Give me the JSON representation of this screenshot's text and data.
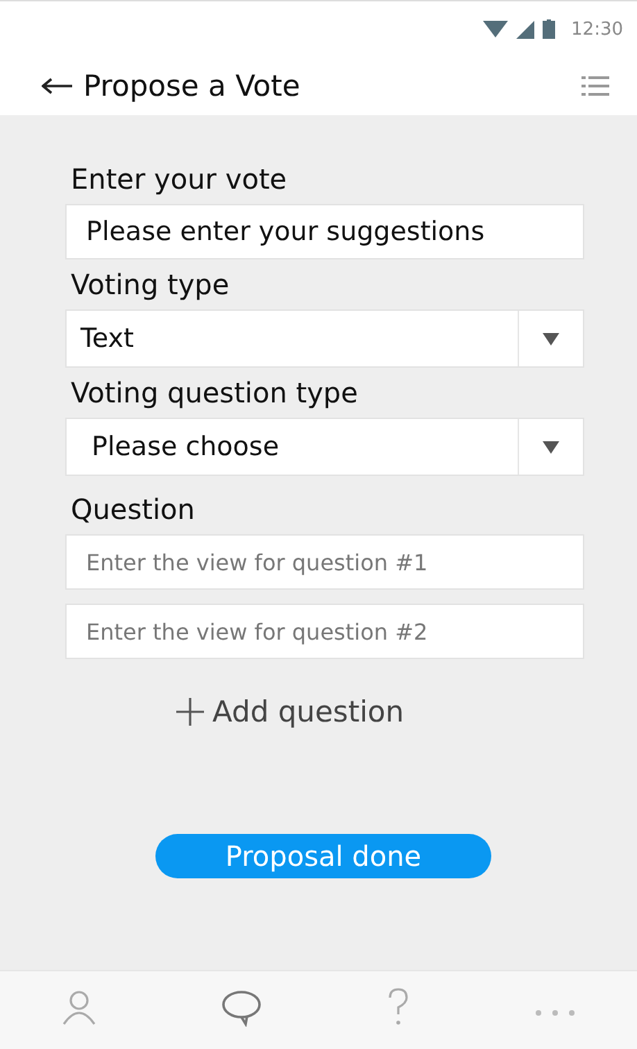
{
  "status_bar": {
    "time": "12:30"
  },
  "header": {
    "title": "Propose a Vote"
  },
  "form": [
    {
      "kind": "text",
      "label": "Enter your vote",
      "placeholder": "Please enter your suggestions"
    },
    {
      "kind": "select",
      "label": "Voting type",
      "value": "Text"
    },
    {
      "kind": "select",
      "label": "Voting question type",
      "value": "Please choose"
    }
  ],
  "question": {
    "label": "Question",
    "fields": [
      {
        "placeholder": "Enter the view for question #1"
      },
      {
        "placeholder": "Enter the view for question #2"
      }
    ],
    "add_label": "Add question"
  },
  "submit": {
    "label": "Proposal done"
  },
  "bottom_nav": [
    {
      "kind": "person",
      "selected": false
    },
    {
      "kind": "chat",
      "selected": false
    },
    {
      "kind": "help",
      "selected": false
    },
    {
      "kind": "more",
      "selected": false
    }
  ]
}
